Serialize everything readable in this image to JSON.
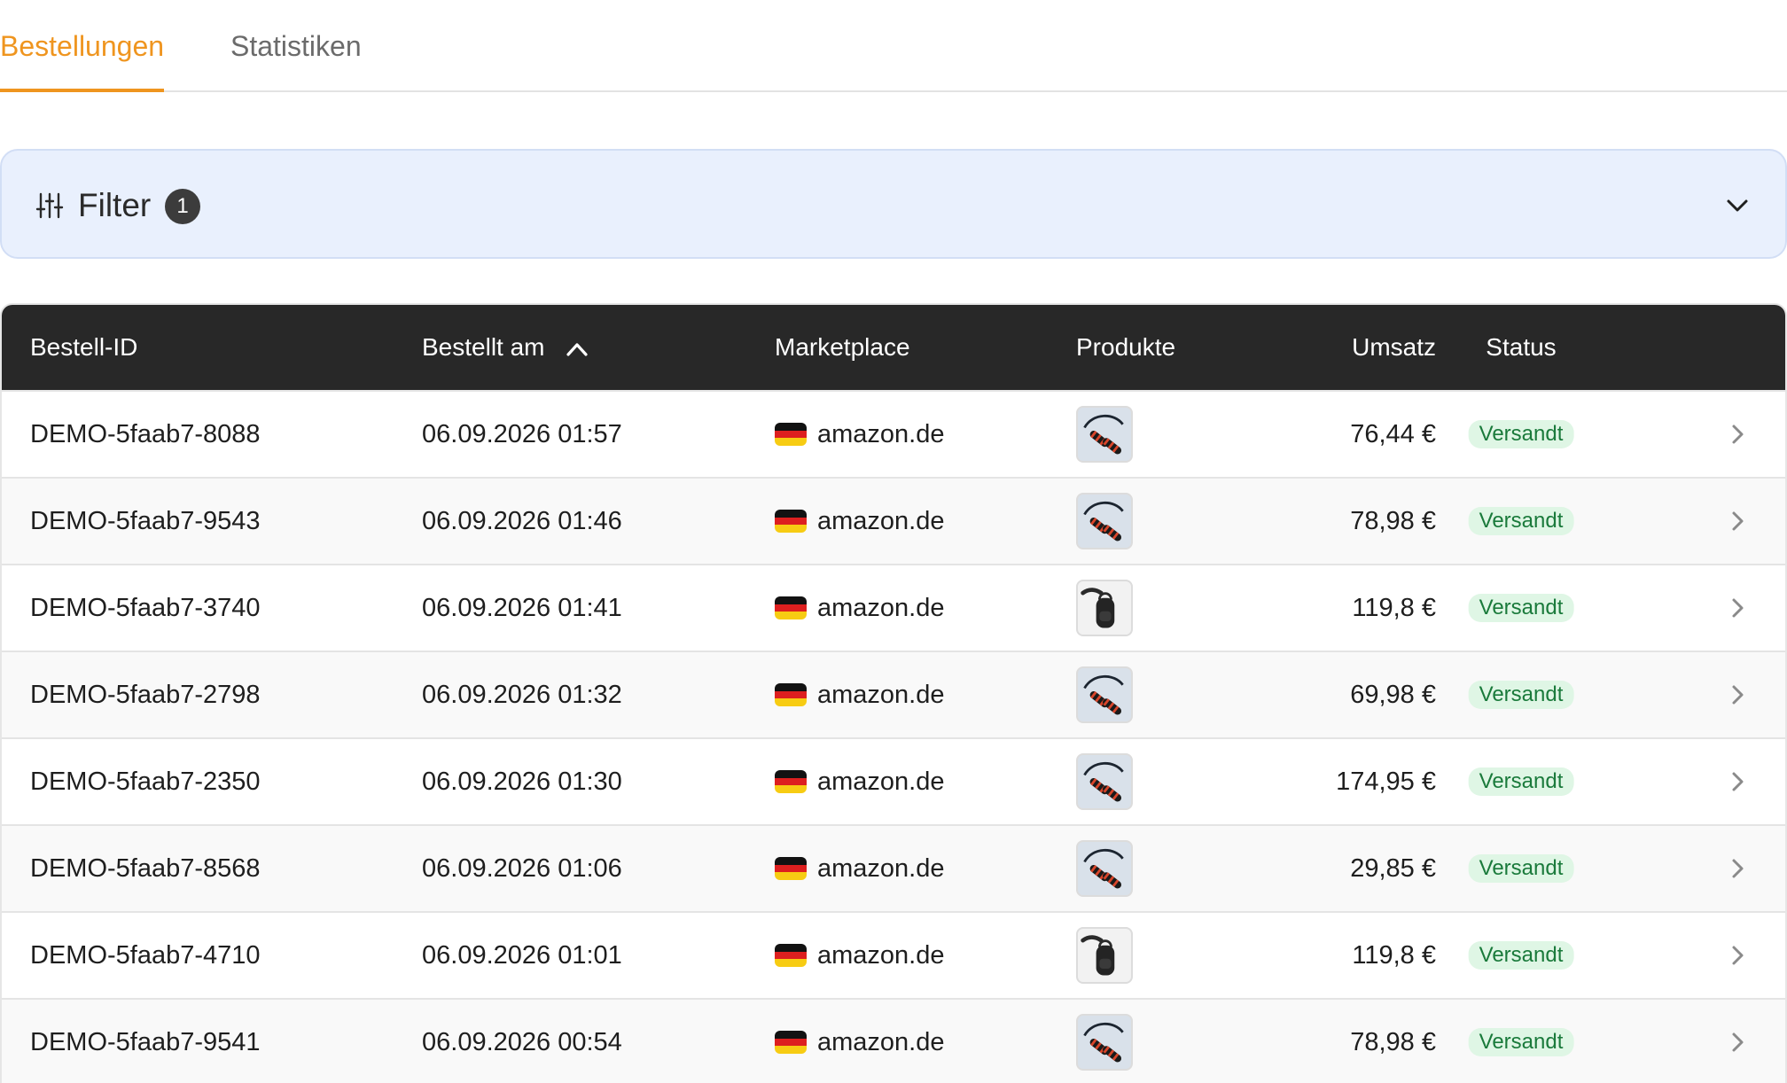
{
  "tabs": [
    {
      "label": "Bestellungen",
      "active": true
    },
    {
      "label": "Statistiken",
      "active": false
    }
  ],
  "filter": {
    "label": "Filter",
    "count": "1",
    "icon": "sliders-icon",
    "toggle_icon": "chevron-down-icon"
  },
  "table": {
    "columns": [
      "Bestell-ID",
      "Bestellt am",
      "Marketplace",
      "Produkte",
      "Umsatz",
      "Status"
    ],
    "sort": {
      "column": "Bestellt am",
      "icon": "chevron-up-icon"
    },
    "rows": [
      {
        "id": "DEMO-5faab7-8088",
        "date": "06.09.2026 01:57",
        "marketplace": "amazon.de",
        "product": "jump-rope-image",
        "revenue": "76,44 €",
        "status": "Versandt"
      },
      {
        "id": "DEMO-5faab7-9543",
        "date": "06.09.2026 01:46",
        "marketplace": "amazon.de",
        "product": "jump-rope-image",
        "revenue": "78,98 €",
        "status": "Versandt"
      },
      {
        "id": "DEMO-5faab7-3740",
        "date": "06.09.2026 01:41",
        "marketplace": "amazon.de",
        "product": "backpack-image",
        "revenue": "119,8 €",
        "status": "Versandt"
      },
      {
        "id": "DEMO-5faab7-2798",
        "date": "06.09.2026 01:32",
        "marketplace": "amazon.de",
        "product": "jump-rope-image",
        "revenue": "69,98 €",
        "status": "Versandt"
      },
      {
        "id": "DEMO-5faab7-2350",
        "date": "06.09.2026 01:30",
        "marketplace": "amazon.de",
        "product": "jump-rope-image",
        "revenue": "174,95 €",
        "status": "Versandt"
      },
      {
        "id": "DEMO-5faab7-8568",
        "date": "06.09.2026 01:06",
        "marketplace": "amazon.de",
        "product": "jump-rope-image",
        "revenue": "29,85 €",
        "status": "Versandt"
      },
      {
        "id": "DEMO-5faab7-4710",
        "date": "06.09.2026 01:01",
        "marketplace": "amazon.de",
        "product": "backpack-image",
        "revenue": "119,8 €",
        "status": "Versandt"
      },
      {
        "id": "DEMO-5faab7-9541",
        "date": "06.09.2026 00:54",
        "marketplace": "amazon.de",
        "product": "jump-rope-image",
        "revenue": "78,98 €",
        "status": "Versandt"
      }
    ]
  },
  "colors": {
    "accent": "#ef951f",
    "filter_bg": "#e9f0fd",
    "header_bg": "#282828",
    "status_bg": "#dff6e5",
    "status_text": "#1a7a3b"
  }
}
